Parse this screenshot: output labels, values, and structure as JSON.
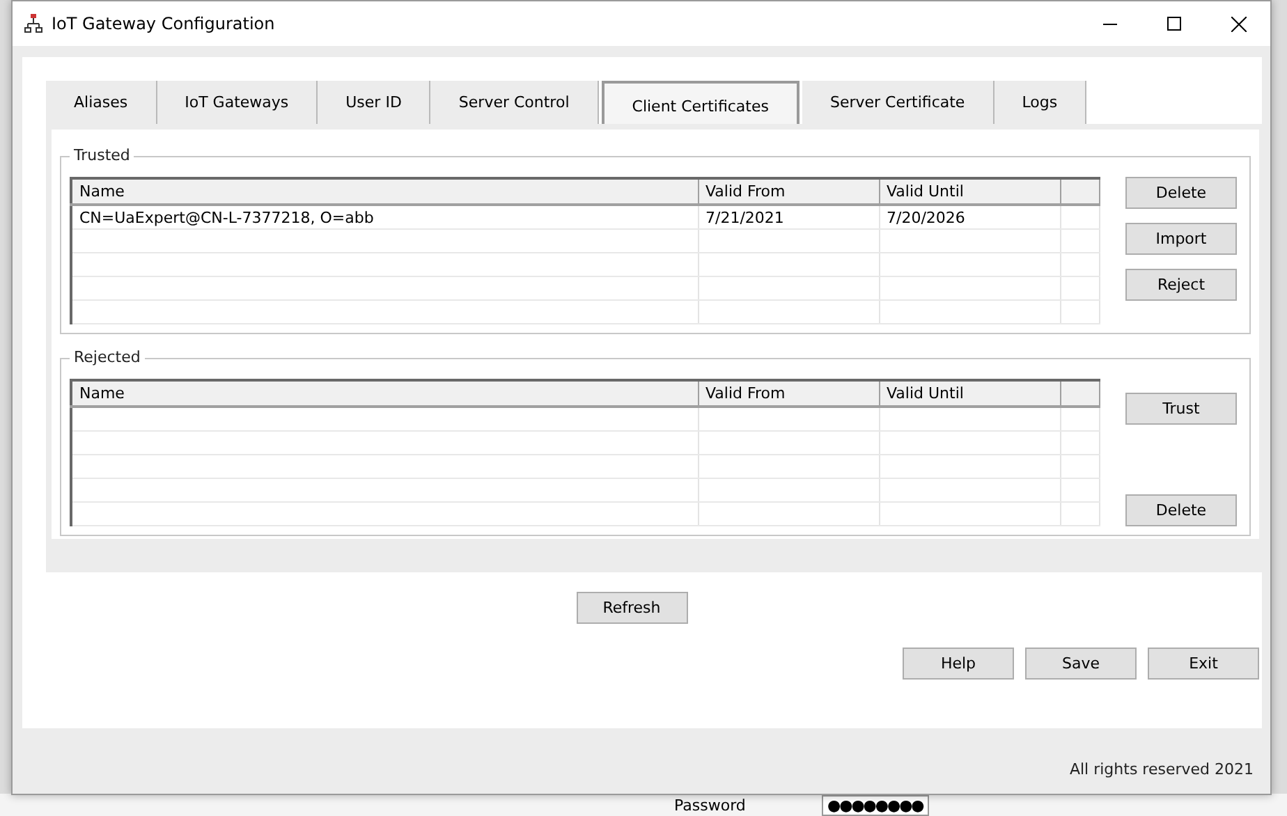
{
  "window": {
    "title": "IoT Gateway Configuration"
  },
  "tabs": [
    {
      "label": "Aliases",
      "selected": false
    },
    {
      "label": "IoT Gateways",
      "selected": false
    },
    {
      "label": "User ID",
      "selected": false
    },
    {
      "label": "Server Control",
      "selected": false
    },
    {
      "label": "Client Certificates",
      "selected": true
    },
    {
      "label": "Server Certificate",
      "selected": false
    },
    {
      "label": "Logs",
      "selected": false
    }
  ],
  "groups": [
    {
      "title": "Trusted",
      "columns": [
        "Name",
        "Valid From",
        "Valid Until"
      ],
      "rows": [
        [
          "CN=UaExpert@CN-L-7377218, O=abb",
          "7/21/2021",
          "7/20/2026"
        ]
      ],
      "buttons": [
        "Delete",
        "Import",
        "Reject"
      ]
    },
    {
      "title": "Rejected",
      "columns": [
        "Name",
        "Valid From",
        "Valid Until"
      ],
      "buttons": [
        "Trust",
        "Delete"
      ]
    }
  ],
  "refresh_button": "Refresh",
  "footer_buttons": [
    "Help",
    "Save",
    "Exit"
  ],
  "footer": "All rights reserved 2021",
  "background_window": {
    "password_label": "Password",
    "password_value": "●●●●●●●●"
  }
}
